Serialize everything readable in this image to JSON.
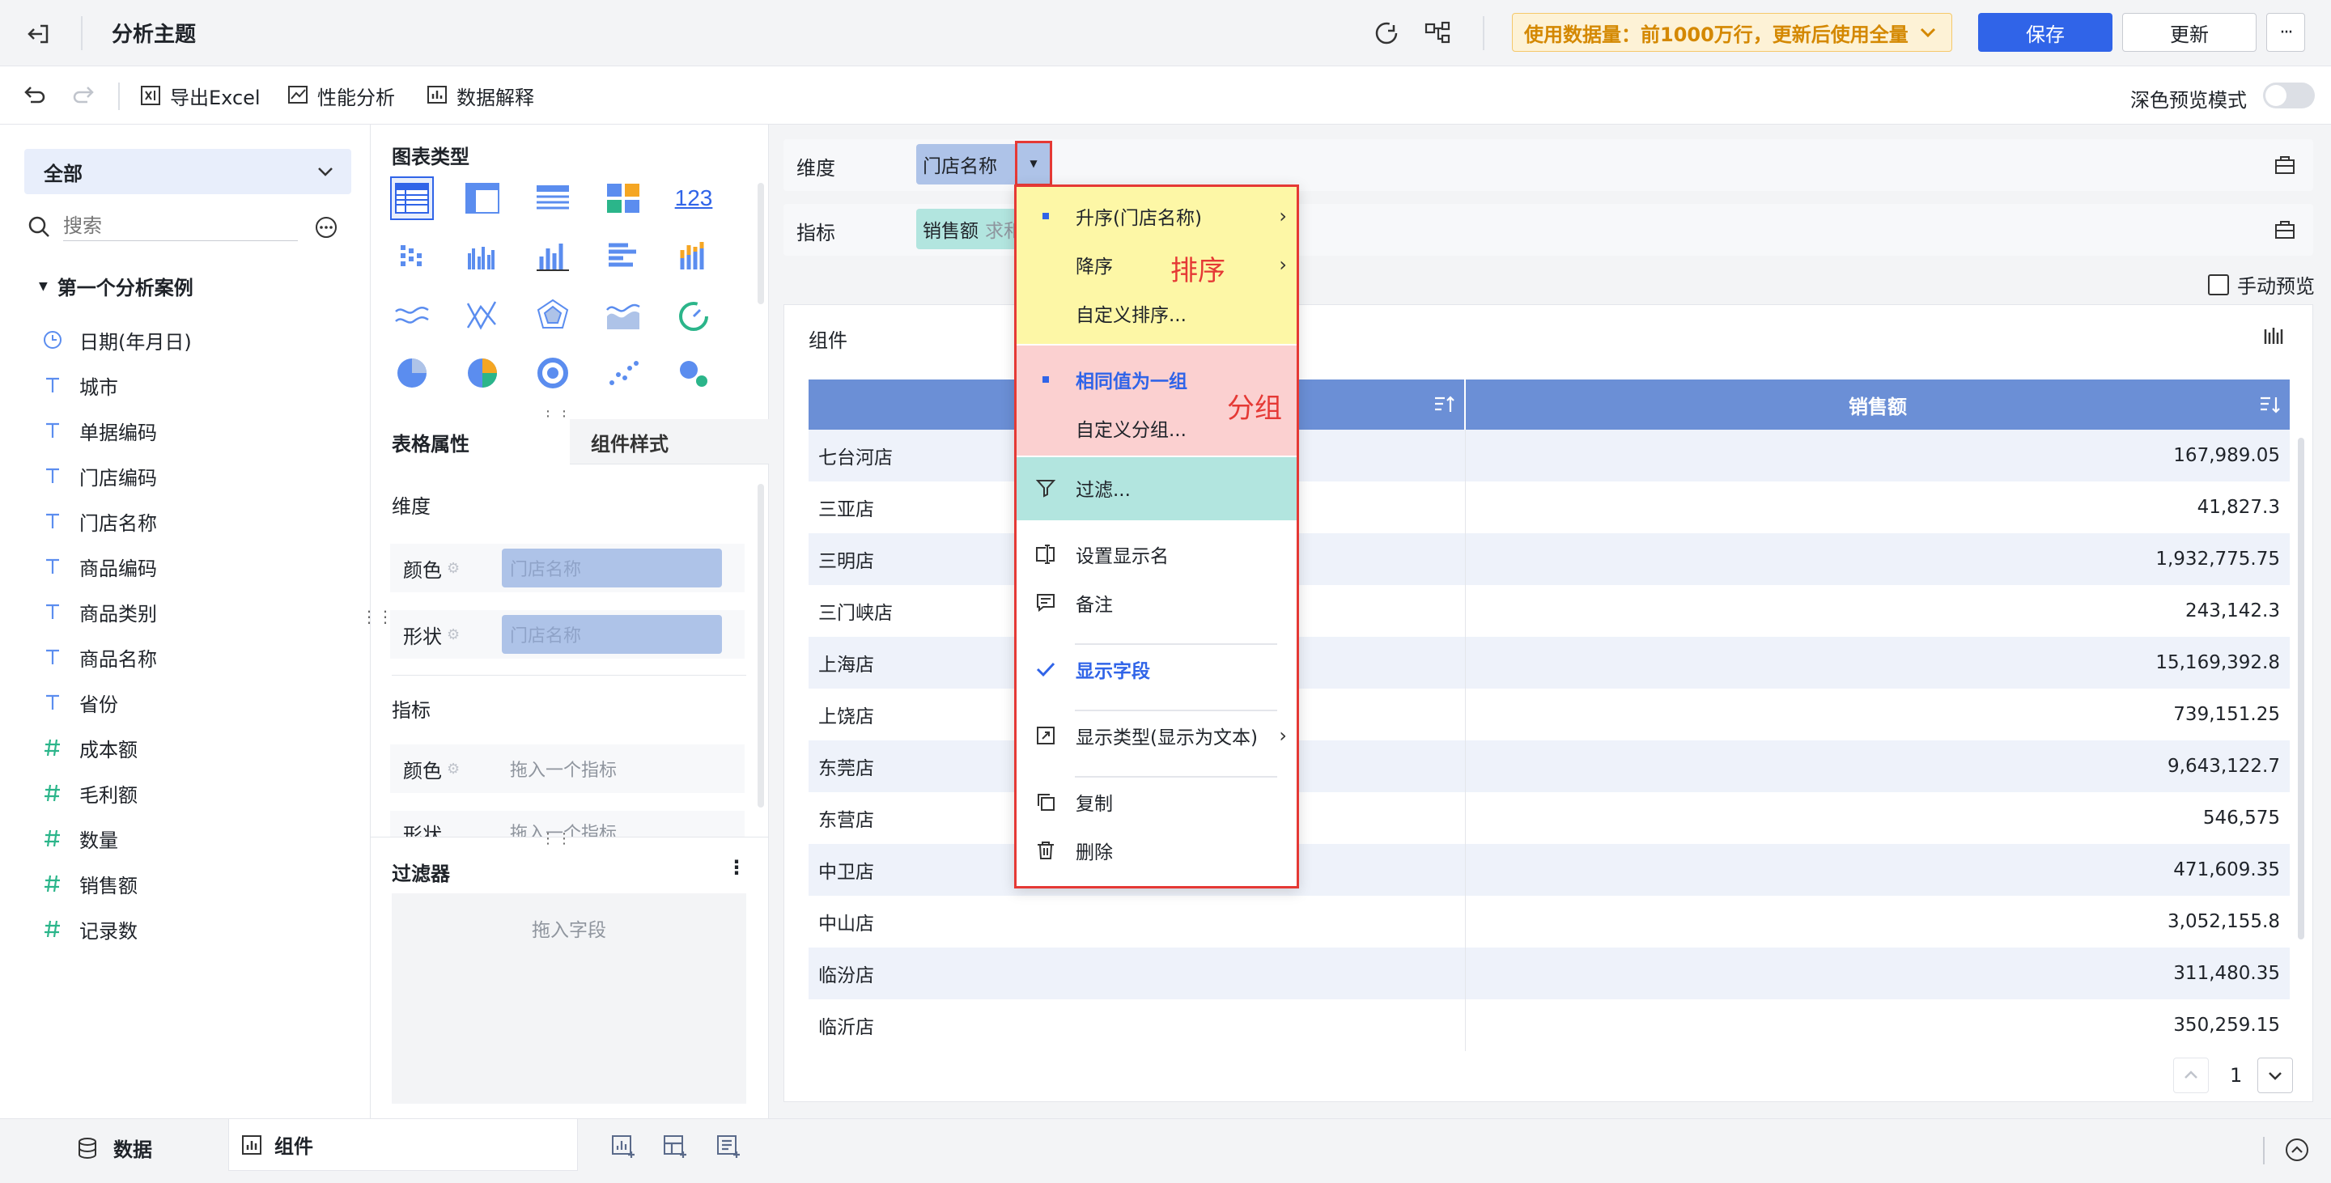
{
  "topbar": {
    "title": "分析主题",
    "notice": "使用数据量：前1000万行，更新后使用全量",
    "save_label": "保存",
    "update_label": "更新",
    "more_label": "···"
  },
  "toolbar": {
    "export_excel": "导出Excel",
    "perf_analysis": "性能分析",
    "data_explain": "数据解释",
    "dark_preview": "深色预览模式"
  },
  "fields_panel": {
    "scope_select": "全部",
    "search_placeholder": "搜索",
    "group_name": "第一个分析案例",
    "fields": [
      {
        "label": "日期(年月日)",
        "icon": "clock-icon"
      },
      {
        "label": "城市",
        "icon": "text-type-icon"
      },
      {
        "label": "单据编码",
        "icon": "text-type-icon"
      },
      {
        "label": "门店编码",
        "icon": "text-type-icon"
      },
      {
        "label": "门店名称",
        "icon": "text-type-icon"
      },
      {
        "label": "商品编码",
        "icon": "text-type-icon"
      },
      {
        "label": "商品类别",
        "icon": "text-type-icon"
      },
      {
        "label": "商品名称",
        "icon": "text-type-icon"
      },
      {
        "label": "省份",
        "icon": "text-type-icon"
      },
      {
        "label": "成本额",
        "icon": "number-type-icon"
      },
      {
        "label": "毛利额",
        "icon": "number-type-icon"
      },
      {
        "label": "数量",
        "icon": "number-type-icon"
      },
      {
        "label": "销售额",
        "icon": "number-type-icon"
      },
      {
        "label": "记录数",
        "icon": "number-type-icon"
      }
    ]
  },
  "chart_panel": {
    "chart_type_title": "图表类型",
    "tab_table_props": "表格属性",
    "tab_component_style": "组件样式",
    "dimension_title": "维度",
    "color_label": "颜色",
    "shape_label": "形状",
    "dim_color_value": "门店名称",
    "dim_shape_value": "门店名称",
    "measure_title": "指标",
    "measure_color_placeholder": "拖入一个指标",
    "measure_shape_placeholder": "拖入一个指标",
    "filter_title": "过滤器",
    "filter_placeholder": "拖入字段",
    "number_icon_text": "123"
  },
  "main": {
    "dimension_label": "维度",
    "dimension_pill": "门店名称",
    "measure_label": "指标",
    "measure_pill": "销售额",
    "measure_pill_agg": "求和",
    "manual_preview": "手动预览",
    "widget_title": "组件",
    "table": {
      "col2_header": "销售额",
      "rows": [
        {
          "name": "七台河店",
          "value": "167,989.05"
        },
        {
          "name": "三亚店",
          "value": "41,827.3"
        },
        {
          "name": "三明店",
          "value": "1,932,775.75"
        },
        {
          "name": "三门峡店",
          "value": "243,142.3"
        },
        {
          "name": "上海店",
          "value": "15,169,392.8"
        },
        {
          "name": "上饶店",
          "value": "739,151.25"
        },
        {
          "name": "东莞店",
          "value": "9,643,122.7"
        },
        {
          "name": "东营店",
          "value": "546,575"
        },
        {
          "name": "中卫店",
          "value": "471,609.35"
        },
        {
          "name": "中山店",
          "value": "3,052,155.8"
        },
        {
          "name": "临汾店",
          "value": "311,480.35"
        },
        {
          "name": "临沂店",
          "value": "350,259.15"
        }
      ]
    },
    "page_number": "1"
  },
  "context_menu": {
    "sort_asc": "升序(门店名称)",
    "sort_desc": "降序",
    "sort_custom": "自定义排序...",
    "sort_annotation": "排序",
    "group_same": "相同值为一组",
    "group_custom": "自定义分组...",
    "group_annotation": "分组",
    "filter": "过滤...",
    "set_display_name": "设置显示名",
    "note": "备注",
    "show_field": "显示字段",
    "display_type": "显示类型(显示为文本)",
    "copy": "复制",
    "delete": "删除"
  },
  "bottombar": {
    "data_tab": "数据",
    "component_tab": "组件"
  },
  "colors": {
    "primary": "#3064e8",
    "sort_bg": "#fdf7a6",
    "group_bg": "#fbd0d0",
    "filter_bg": "#b2e5df",
    "annotation_red": "#e53935",
    "table_header": "#6b8fd6"
  }
}
